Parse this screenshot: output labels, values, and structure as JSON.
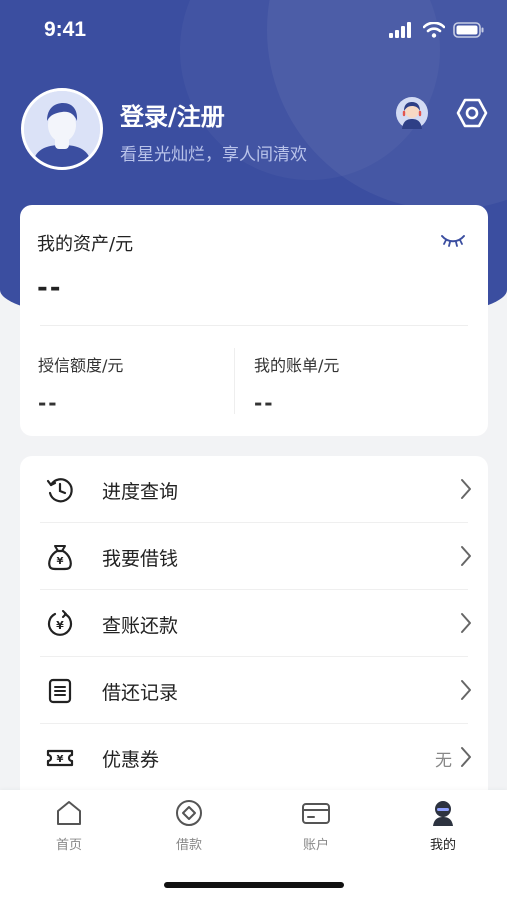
{
  "status_bar": {
    "time": "9:41"
  },
  "profile": {
    "title": "登录/注册",
    "subtitle": "看星光灿烂，享人间清欢",
    "avatar_icon": "user-avatar-icon"
  },
  "assets": {
    "label": "我的资产/元",
    "value": "--",
    "credit_label": "授信额度/元",
    "credit_value": "--",
    "bill_label": "我的账单/元",
    "bill_value": "--"
  },
  "menu": [
    {
      "label": "进度查询",
      "icon": "clock-history-icon",
      "value": ""
    },
    {
      "label": "我要借钱",
      "icon": "money-bag-icon",
      "value": ""
    },
    {
      "label": "查账还款",
      "icon": "yuan-refresh-icon",
      "value": ""
    },
    {
      "label": "借还记录",
      "icon": "document-list-icon",
      "value": ""
    },
    {
      "label": "优惠券",
      "icon": "coupon-icon",
      "value": "无"
    }
  ],
  "tabs": [
    {
      "label": "首页",
      "icon": "home-icon",
      "active": false
    },
    {
      "label": "借款",
      "icon": "loan-icon",
      "active": false
    },
    {
      "label": "账户",
      "icon": "card-icon",
      "active": false
    },
    {
      "label": "我的",
      "icon": "profile-icon",
      "active": true
    }
  ],
  "colors": {
    "brand": "#3b4ea0",
    "background": "#f2f3f5",
    "text": "#222222"
  }
}
